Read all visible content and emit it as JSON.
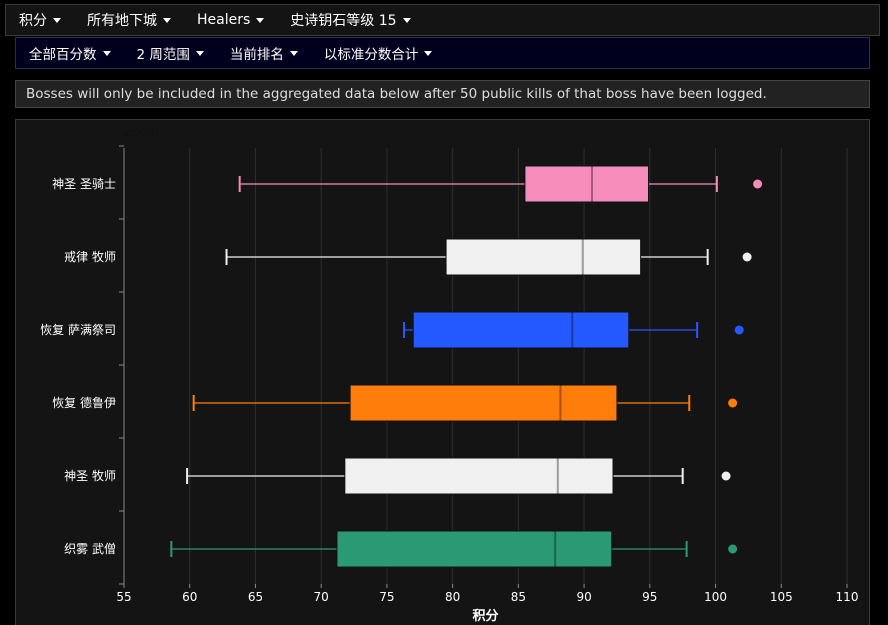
{
  "top_nav": {
    "items": [
      {
        "label": "积分"
      },
      {
        "label": "所有地下城"
      },
      {
        "label": "Healers"
      },
      {
        "label": "史诗钥石等级 15"
      }
    ]
  },
  "sub_nav": {
    "items": [
      {
        "label": "全部百分数"
      },
      {
        "label": "2 周范围"
      },
      {
        "label": "当前排名"
      },
      {
        "label": "以标准分数合计"
      }
    ]
  },
  "notice": {
    "text": "Bosses will only be included in the aggregated data below after 50 public kills of that boss have been logged."
  },
  "zoom": {
    "label": "Zoom"
  },
  "colors": {
    "background": "#141414",
    "grid": "#2e2e2e"
  },
  "chart_data": {
    "type": "boxplot",
    "orientation": "horizontal",
    "xlabel": "积分",
    "xlim": [
      55,
      110
    ],
    "xticks": [
      55,
      60,
      65,
      70,
      75,
      80,
      85,
      90,
      95,
      100,
      105,
      110
    ],
    "grid": true,
    "series": [
      {
        "name": "神圣 圣骑士",
        "color": "#f58cba",
        "min": 63.8,
        "q1": 85.5,
        "median": 90.6,
        "q3": 94.9,
        "max": 100.1,
        "outlier": 103.2
      },
      {
        "name": "戒律 牧师",
        "color": "#f0f0f0",
        "min": 62.8,
        "q1": 79.5,
        "median": 89.9,
        "q3": 94.3,
        "max": 99.4,
        "outlier": 102.4
      },
      {
        "name": "恢复 萨满祭司",
        "color": "#2459ff",
        "min": 76.3,
        "q1": 77.0,
        "median": 89.1,
        "q3": 93.4,
        "max": 98.6,
        "outlier": 101.8
      },
      {
        "name": "恢复 德鲁伊",
        "color": "#ff7d0a",
        "min": 60.3,
        "q1": 72.2,
        "median": 88.2,
        "q3": 92.5,
        "max": 98.0,
        "outlier": 101.3
      },
      {
        "name": "神圣 牧师",
        "color": "#f0f0f0",
        "min": 59.8,
        "q1": 71.8,
        "median": 88.0,
        "q3": 92.2,
        "max": 97.5,
        "outlier": 100.8
      },
      {
        "name": "织雾 武僧",
        "color": "#2a9a74",
        "min": 58.6,
        "q1": 71.2,
        "median": 87.8,
        "q3": 92.1,
        "max": 97.8,
        "outlier": 101.3
      }
    ]
  }
}
